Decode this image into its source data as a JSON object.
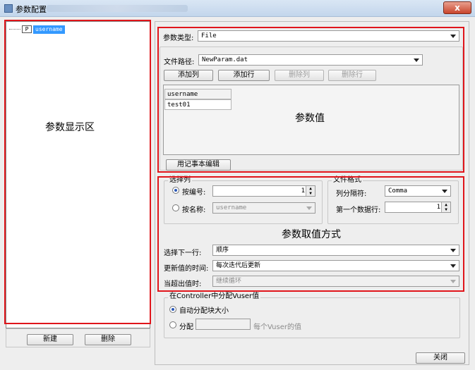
{
  "window": {
    "title": "参数配置",
    "close_label": "x"
  },
  "tree": {
    "node_icon": "P",
    "node_label": "username"
  },
  "left_buttons": {
    "new": "新建",
    "delete": "删除"
  },
  "annotations": {
    "display_area": "参数显示区",
    "param_value": "参数值",
    "value_method": "参数取值方式"
  },
  "param_type": {
    "label": "参数类型:",
    "value": "File"
  },
  "file_path": {
    "label": "文件路径:",
    "value": "NewParam.dat"
  },
  "file_buttons": {
    "add_col": "添加列",
    "add_row": "添加行",
    "del_col": "删除列",
    "del_row": "删除行"
  },
  "table": {
    "header": "username",
    "rows": [
      "test01"
    ]
  },
  "notepad_button": "用记事本编辑",
  "select_column": {
    "title": "选择列",
    "by_number_label": "按编号:",
    "by_number_value": "1",
    "by_name_label": "按名称:",
    "by_name_value": "username"
  },
  "file_format": {
    "title": "文件格式",
    "delimiter_label": "列分隔符:",
    "delimiter_value": "Comma",
    "first_row_label": "第一个数据行:",
    "first_row_value": "1"
  },
  "select_next_row": {
    "label": "选择下一行:",
    "value": "顺序"
  },
  "update_value_on": {
    "label": "更新值的时间:",
    "value": "每次迭代后更新"
  },
  "when_out_of_values": {
    "label": "当超出值时:",
    "value": "继续循环"
  },
  "controller": {
    "title": "在Controller中分配Vuser值",
    "auto_label": "自动分配块大小",
    "allocate_label": "分配",
    "allocate_value": "",
    "per_vuser_label": "每个Vuser的值"
  },
  "close_button": "关闭"
}
